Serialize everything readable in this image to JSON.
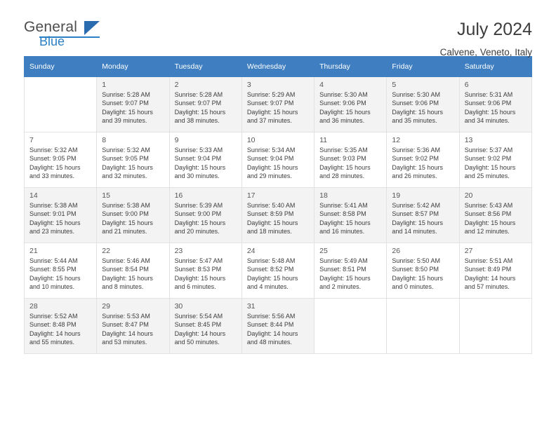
{
  "logo": {
    "general": "General",
    "blue": "Blue"
  },
  "header": {
    "title": "July 2024",
    "subtitle": "Calvene, Veneto, Italy"
  },
  "columns": [
    "Sunday",
    "Monday",
    "Tuesday",
    "Wednesday",
    "Thursday",
    "Friday",
    "Saturday"
  ],
  "weeks": [
    [
      {
        "day": "",
        "lines": []
      },
      {
        "day": "1",
        "lines": [
          "Sunrise: 5:28 AM",
          "Sunset: 9:07 PM",
          "Daylight: 15 hours",
          "and 39 minutes."
        ]
      },
      {
        "day": "2",
        "lines": [
          "Sunrise: 5:28 AM",
          "Sunset: 9:07 PM",
          "Daylight: 15 hours",
          "and 38 minutes."
        ]
      },
      {
        "day": "3",
        "lines": [
          "Sunrise: 5:29 AM",
          "Sunset: 9:07 PM",
          "Daylight: 15 hours",
          "and 37 minutes."
        ]
      },
      {
        "day": "4",
        "lines": [
          "Sunrise: 5:30 AM",
          "Sunset: 9:06 PM",
          "Daylight: 15 hours",
          "and 36 minutes."
        ]
      },
      {
        "day": "5",
        "lines": [
          "Sunrise: 5:30 AM",
          "Sunset: 9:06 PM",
          "Daylight: 15 hours",
          "and 35 minutes."
        ]
      },
      {
        "day": "6",
        "lines": [
          "Sunrise: 5:31 AM",
          "Sunset: 9:06 PM",
          "Daylight: 15 hours",
          "and 34 minutes."
        ]
      }
    ],
    [
      {
        "day": "7",
        "lines": [
          "Sunrise: 5:32 AM",
          "Sunset: 9:05 PM",
          "Daylight: 15 hours",
          "and 33 minutes."
        ]
      },
      {
        "day": "8",
        "lines": [
          "Sunrise: 5:32 AM",
          "Sunset: 9:05 PM",
          "Daylight: 15 hours",
          "and 32 minutes."
        ]
      },
      {
        "day": "9",
        "lines": [
          "Sunrise: 5:33 AM",
          "Sunset: 9:04 PM",
          "Daylight: 15 hours",
          "and 30 minutes."
        ]
      },
      {
        "day": "10",
        "lines": [
          "Sunrise: 5:34 AM",
          "Sunset: 9:04 PM",
          "Daylight: 15 hours",
          "and 29 minutes."
        ]
      },
      {
        "day": "11",
        "lines": [
          "Sunrise: 5:35 AM",
          "Sunset: 9:03 PM",
          "Daylight: 15 hours",
          "and 28 minutes."
        ]
      },
      {
        "day": "12",
        "lines": [
          "Sunrise: 5:36 AM",
          "Sunset: 9:02 PM",
          "Daylight: 15 hours",
          "and 26 minutes."
        ]
      },
      {
        "day": "13",
        "lines": [
          "Sunrise: 5:37 AM",
          "Sunset: 9:02 PM",
          "Daylight: 15 hours",
          "and 25 minutes."
        ]
      }
    ],
    [
      {
        "day": "14",
        "lines": [
          "Sunrise: 5:38 AM",
          "Sunset: 9:01 PM",
          "Daylight: 15 hours",
          "and 23 minutes."
        ]
      },
      {
        "day": "15",
        "lines": [
          "Sunrise: 5:38 AM",
          "Sunset: 9:00 PM",
          "Daylight: 15 hours",
          "and 21 minutes."
        ]
      },
      {
        "day": "16",
        "lines": [
          "Sunrise: 5:39 AM",
          "Sunset: 9:00 PM",
          "Daylight: 15 hours",
          "and 20 minutes."
        ]
      },
      {
        "day": "17",
        "lines": [
          "Sunrise: 5:40 AM",
          "Sunset: 8:59 PM",
          "Daylight: 15 hours",
          "and 18 minutes."
        ]
      },
      {
        "day": "18",
        "lines": [
          "Sunrise: 5:41 AM",
          "Sunset: 8:58 PM",
          "Daylight: 15 hours",
          "and 16 minutes."
        ]
      },
      {
        "day": "19",
        "lines": [
          "Sunrise: 5:42 AM",
          "Sunset: 8:57 PM",
          "Daylight: 15 hours",
          "and 14 minutes."
        ]
      },
      {
        "day": "20",
        "lines": [
          "Sunrise: 5:43 AM",
          "Sunset: 8:56 PM",
          "Daylight: 15 hours",
          "and 12 minutes."
        ]
      }
    ],
    [
      {
        "day": "21",
        "lines": [
          "Sunrise: 5:44 AM",
          "Sunset: 8:55 PM",
          "Daylight: 15 hours",
          "and 10 minutes."
        ]
      },
      {
        "day": "22",
        "lines": [
          "Sunrise: 5:46 AM",
          "Sunset: 8:54 PM",
          "Daylight: 15 hours",
          "and 8 minutes."
        ]
      },
      {
        "day": "23",
        "lines": [
          "Sunrise: 5:47 AM",
          "Sunset: 8:53 PM",
          "Daylight: 15 hours",
          "and 6 minutes."
        ]
      },
      {
        "day": "24",
        "lines": [
          "Sunrise: 5:48 AM",
          "Sunset: 8:52 PM",
          "Daylight: 15 hours",
          "and 4 minutes."
        ]
      },
      {
        "day": "25",
        "lines": [
          "Sunrise: 5:49 AM",
          "Sunset: 8:51 PM",
          "Daylight: 15 hours",
          "and 2 minutes."
        ]
      },
      {
        "day": "26",
        "lines": [
          "Sunrise: 5:50 AM",
          "Sunset: 8:50 PM",
          "Daylight: 15 hours",
          "and 0 minutes."
        ]
      },
      {
        "day": "27",
        "lines": [
          "Sunrise: 5:51 AM",
          "Sunset: 8:49 PM",
          "Daylight: 14 hours",
          "and 57 minutes."
        ]
      }
    ],
    [
      {
        "day": "28",
        "lines": [
          "Sunrise: 5:52 AM",
          "Sunset: 8:48 PM",
          "Daylight: 14 hours",
          "and 55 minutes."
        ]
      },
      {
        "day": "29",
        "lines": [
          "Sunrise: 5:53 AM",
          "Sunset: 8:47 PM",
          "Daylight: 14 hours",
          "and 53 minutes."
        ]
      },
      {
        "day": "30",
        "lines": [
          "Sunrise: 5:54 AM",
          "Sunset: 8:45 PM",
          "Daylight: 14 hours",
          "and 50 minutes."
        ]
      },
      {
        "day": "31",
        "lines": [
          "Sunrise: 5:56 AM",
          "Sunset: 8:44 PM",
          "Daylight: 14 hours",
          "and 48 minutes."
        ]
      },
      {
        "day": "",
        "lines": []
      },
      {
        "day": "",
        "lines": []
      },
      {
        "day": "",
        "lines": []
      }
    ]
  ]
}
